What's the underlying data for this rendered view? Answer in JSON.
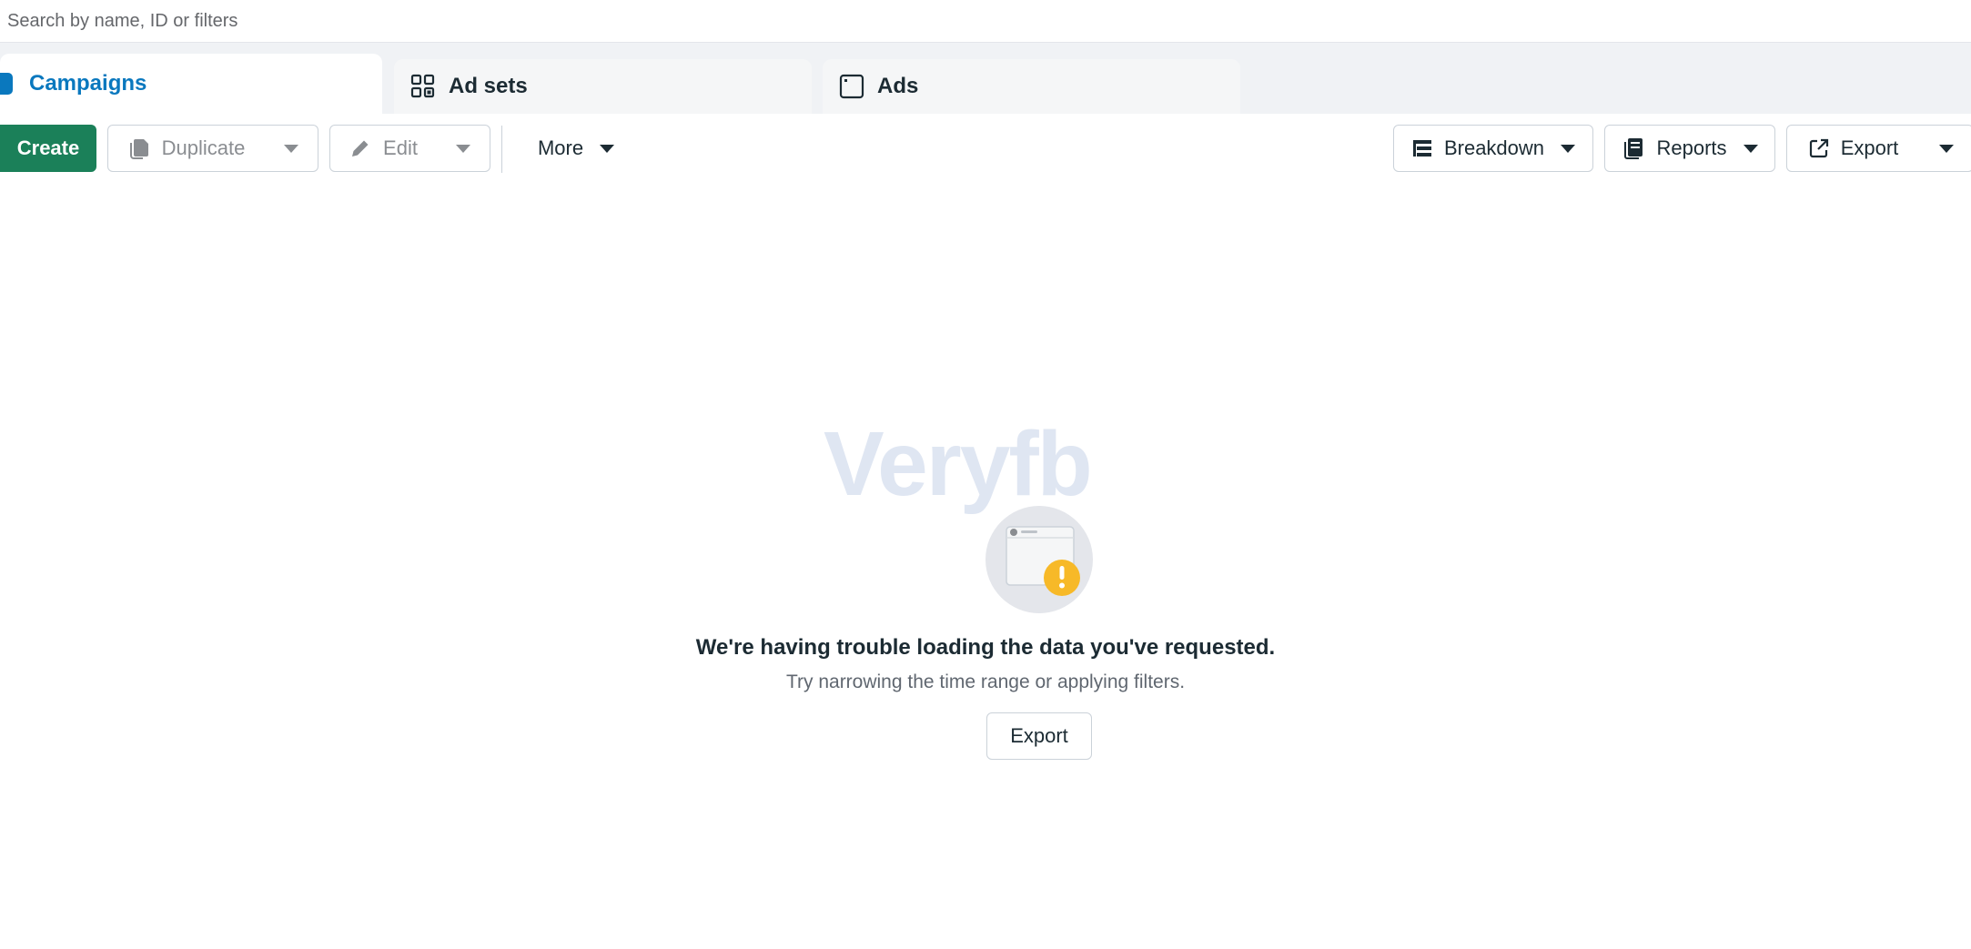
{
  "search": {
    "placeholder": "Search by name, ID or filters",
    "value": ""
  },
  "tabs": [
    {
      "label": "Campaigns",
      "icon": "campaign-icon",
      "active": true
    },
    {
      "label": "Ad sets",
      "icon": "grid-icon",
      "active": false
    },
    {
      "label": "Ads",
      "icon": "ad-window-icon",
      "active": false
    }
  ],
  "toolbar": {
    "create_label": "Create",
    "duplicate_label": "Duplicate",
    "edit_label": "Edit",
    "more_label": "More",
    "breakdown_label": "Breakdown",
    "reports_label": "Reports",
    "export_label": "Export"
  },
  "watermark": "Veryfb",
  "error": {
    "title": "We're having trouble loading the data you've requested.",
    "subtitle": "Try narrowing the time range or applying filters.",
    "button_label": "Export",
    "icon": "warning-icon"
  },
  "colors": {
    "brand_blue": "#0a78be",
    "create_green": "#1b8059",
    "warning_yellow": "#f7b928"
  }
}
